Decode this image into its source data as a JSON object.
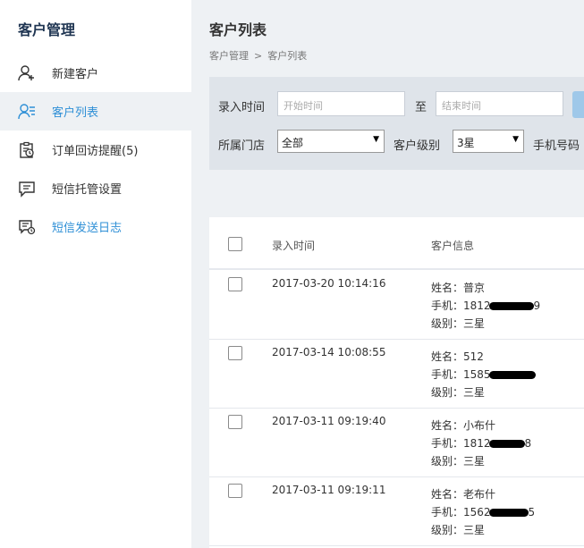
{
  "sidebar": {
    "title": "客户管理",
    "items": [
      {
        "label": "新建客户",
        "icon": "add-user-icon"
      },
      {
        "label": "客户列表",
        "icon": "user-list-icon"
      },
      {
        "label": "订单回访提醒(5)",
        "icon": "clipboard-clock-icon"
      },
      {
        "label": "短信托管设置",
        "icon": "message-icon"
      },
      {
        "label": "短信发送日志",
        "icon": "message-log-icon"
      }
    ]
  },
  "header": {
    "title": "客户列表",
    "breadcrumb": [
      "客户管理",
      ">",
      "客户列表"
    ]
  },
  "filters": {
    "time_label": "录入时间",
    "start_placeholder": "开始时间",
    "to_label": "至",
    "end_placeholder": "结束时间",
    "store_label": "所属门店",
    "store_value": "全部",
    "level_label": "客户级别",
    "level_value": "3星",
    "phone_label": "手机号码"
  },
  "table": {
    "columns": [
      "录入时间",
      "客户信息"
    ],
    "rows": [
      {
        "time": "2017-03-20 10:14:16",
        "name": "姓名：普京",
        "phone": "手机：1812",
        "phone_tail": "9",
        "level": "级别：三星"
      },
      {
        "time": "2017-03-14 10:08:55",
        "name": "姓名：512",
        "phone": "手机：1585",
        "phone_tail": "",
        "level": "级别：三星"
      },
      {
        "time": "2017-03-11 09:19:40",
        "name": "姓名：小布什",
        "phone": "手机：1812",
        "phone_tail": "8",
        "level": "级别：三星"
      },
      {
        "time": "2017-03-11 09:19:11",
        "name": "姓名：老布什",
        "phone": "手机：1562",
        "phone_tail": "5",
        "level": "级别：三星"
      }
    ]
  },
  "colors": {
    "accent": "#2e8fd6",
    "sidebar_bg": "#ffffff",
    "page_bg": "#eef1f4"
  }
}
